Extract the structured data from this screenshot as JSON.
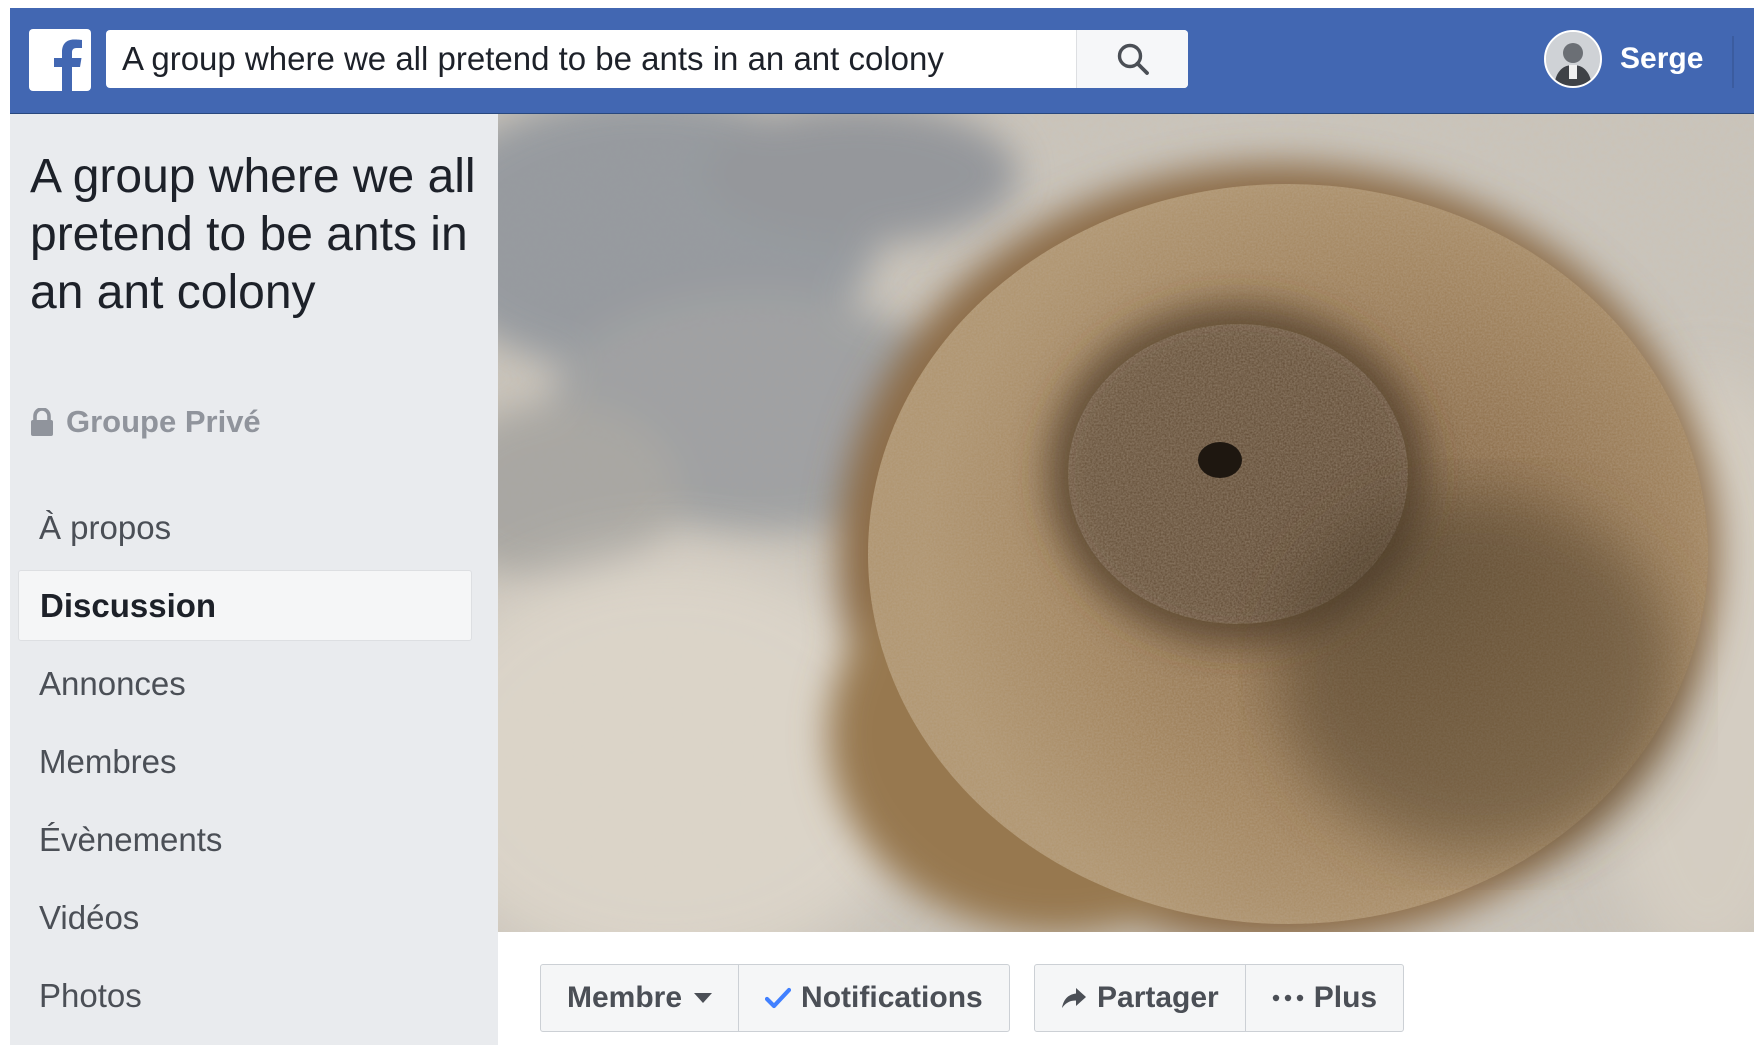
{
  "topbar": {
    "logo_icon": "facebook-f-icon",
    "search": {
      "value": "A group where we all pretend to be ants in an ant colony",
      "icon": "search-icon"
    },
    "user": {
      "name": "Serge",
      "avatar_icon": "avatar-photo"
    }
  },
  "group": {
    "title": "A group where we all pretend to be ants in an ant colony",
    "privacy_icon": "lock-icon",
    "privacy": "Groupe Privé"
  },
  "nav": {
    "items": [
      {
        "label": "À propos",
        "active": false
      },
      {
        "label": "Discussion",
        "active": true
      },
      {
        "label": "Annonces",
        "active": false
      },
      {
        "label": "Membres",
        "active": false
      },
      {
        "label": "Évènements",
        "active": false
      },
      {
        "label": "Vidéos",
        "active": false
      },
      {
        "label": "Photos",
        "active": false
      }
    ]
  },
  "actions": {
    "member": {
      "label": "Membre",
      "icon": "caret-down-icon"
    },
    "notifications": {
      "label": "Notifications",
      "icon": "checkmark-icon"
    },
    "share": {
      "label": "Partager",
      "icon": "share-arrow-icon"
    },
    "more": {
      "label": "Plus",
      "icon": "ellipsis-icon"
    }
  },
  "colors": {
    "topbar": "#4267b2",
    "sidebar": "#e9ebee",
    "text_dark": "#1d2129",
    "text_muted": "#90949c",
    "check": "#4080ff"
  }
}
